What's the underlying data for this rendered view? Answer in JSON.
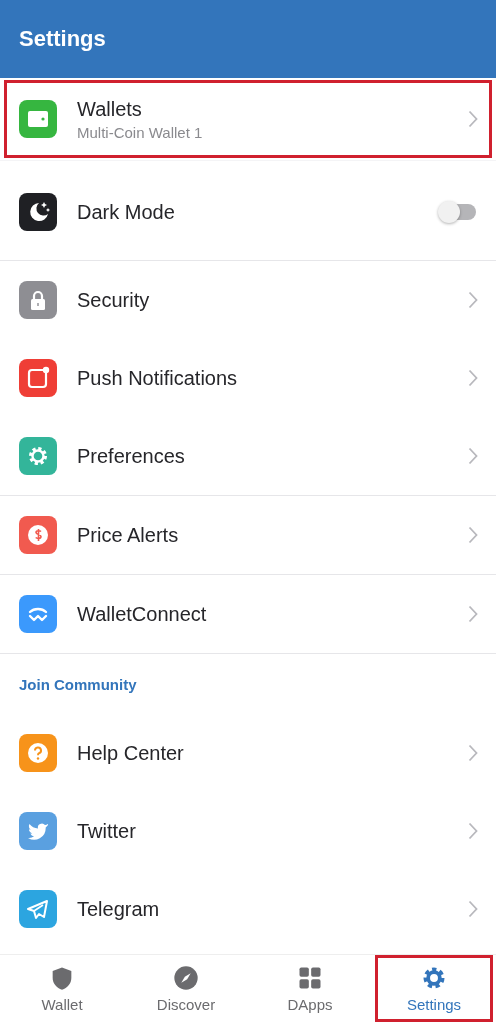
{
  "header": {
    "title": "Settings"
  },
  "sections": [
    {
      "items": [
        {
          "kind": "link",
          "label": "Wallets",
          "subtitle": "Multi-Coin Wallet 1",
          "highlighted": true
        }
      ]
    },
    {
      "items": [
        {
          "kind": "toggle",
          "label": "Dark Mode",
          "on": false
        }
      ]
    },
    {
      "items": [
        {
          "kind": "link",
          "label": "Security"
        },
        {
          "kind": "link",
          "label": "Push Notifications"
        },
        {
          "kind": "link",
          "label": "Preferences"
        }
      ]
    },
    {
      "items": [
        {
          "kind": "link",
          "label": "Price Alerts"
        }
      ]
    },
    {
      "items": [
        {
          "kind": "link",
          "label": "WalletConnect"
        }
      ]
    },
    {
      "heading": "Join Community",
      "items": [
        {
          "kind": "link",
          "label": "Help Center"
        },
        {
          "kind": "link",
          "label": "Twitter"
        },
        {
          "kind": "link",
          "label": "Telegram"
        }
      ]
    }
  ],
  "tabs": [
    {
      "label": "Wallet",
      "selected": false,
      "highlighted": false
    },
    {
      "label": "Discover",
      "selected": false,
      "highlighted": false
    },
    {
      "label": "DApps",
      "selected": false,
      "highlighted": false
    },
    {
      "label": "Settings",
      "selected": true,
      "highlighted": true
    }
  ]
}
